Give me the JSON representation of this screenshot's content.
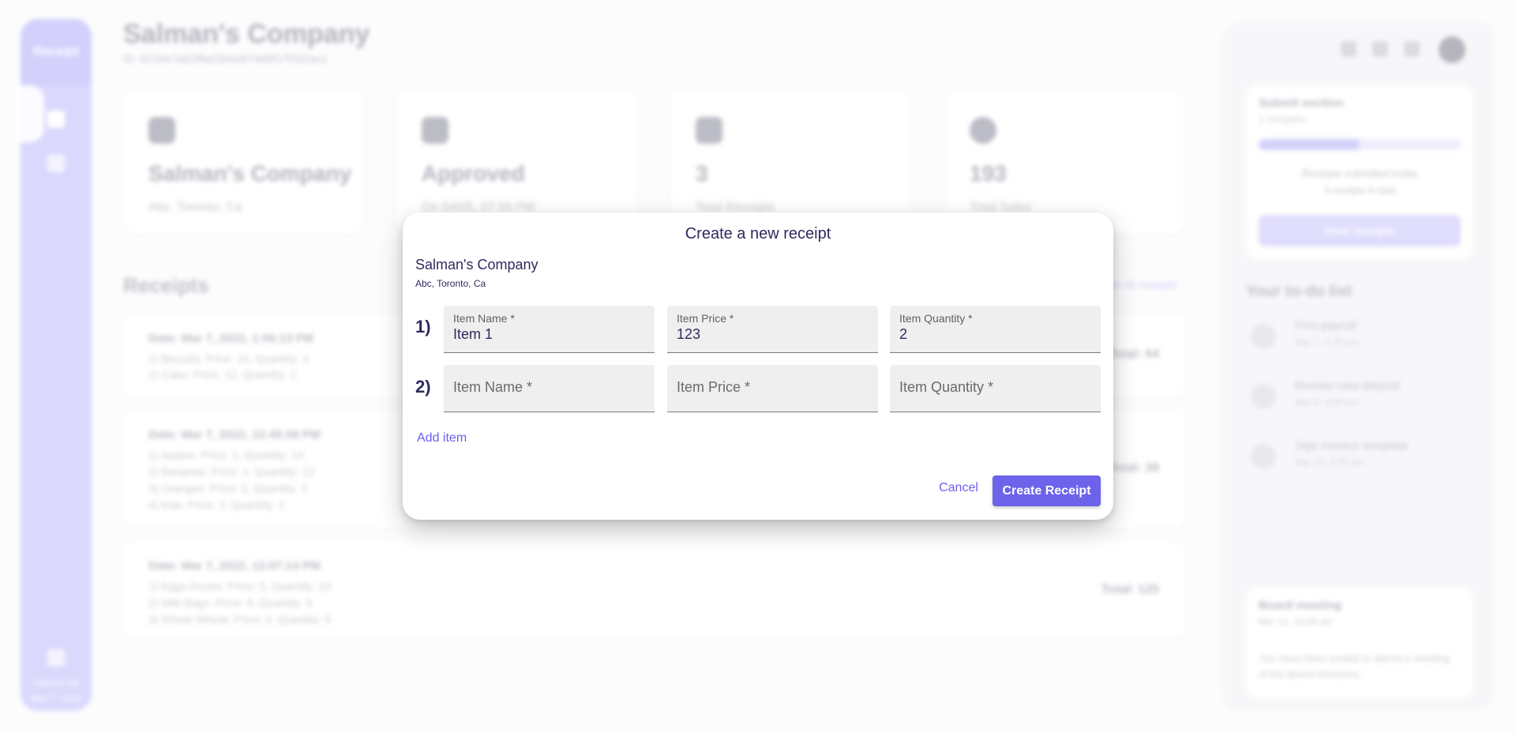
{
  "background": {
    "sidebar": {
      "brand": "Receipt",
      "user_name": "Salman Ali",
      "user_sub": "Mar 7, 2022"
    },
    "header": {
      "title": "Salman's Company",
      "subtitle": "ID: 6234e7ad1f8a22b4a87a66f17f2b2ac1"
    },
    "cards": [
      {
        "value": "Salman's Company",
        "label": "Abc, Toronto, Ca",
        "icon": "briefcase-icon"
      },
      {
        "value": "Approved",
        "label": "On 04/05, 07:56 PM",
        "icon": "check-icon"
      },
      {
        "value": "3",
        "label": "Total Receipts",
        "icon": "receipt-icon"
      },
      {
        "value": "193",
        "label": "Total Sales",
        "icon": "dollar-icon"
      }
    ],
    "receipts_section": {
      "title": "Receipts",
      "view_all": "View all receipts"
    },
    "receipts": [
      {
        "date": "Date: Mar 7, 2022, 1:06:13 PM",
        "items": [
          "1) Biscuits: Price: 10, Quantity: 4",
          "2) Cake: Price: 12, Quantity: 2"
        ],
        "total": "Total: 64"
      },
      {
        "date": "Date: Mar 7, 2022, 12:45:58 PM",
        "items": [
          "1) Apples: Price: 1, Quantity: 10",
          "2) Bananas: Price: 1, Quantity: 12",
          "3) Oranges: Price: 2, Quantity: 3",
          "4) Kiwi: Price: 2, Quantity: 2"
        ],
        "total": "Total: 38"
      },
      {
        "date": "Date: Mar 7, 2022, 12:07:14 PM",
        "items": [
          "1) Eggs Dozen: Price: 5, Quantity: 10",
          "2) Milk Bags: Price: 8, Quantity: 5",
          "3) Whole Wheat: Price: 5, Quantity: 5"
        ],
        "total": "Total: 125"
      }
    ],
    "right_panel": {
      "progress": {
        "title": "Submit section",
        "sub": "1 complete",
        "text": "Receipts submitted today",
        "text2": "3 receipts in total",
        "button": "View receipts",
        "fraction": 0.5
      },
      "todo_title": "Your to-do list",
      "todos": [
        {
          "name": "First payroll",
          "date": "Mar 7, 2:30 pm"
        },
        {
          "name": "Review new deposit",
          "date": "Mar 8, 3:00 pm"
        },
        {
          "name": "Sign Invoice template",
          "date": "Mar 10, 2:00 pm"
        }
      ],
      "meeting": {
        "title": "Board meeting",
        "date": "Mar 12, 10:00 am",
        "text": "You have been invited to attend a meeting of the Board Directors."
      }
    }
  },
  "dialog": {
    "title": "Create a new receipt",
    "company_name": "Salman's Company",
    "company_address": "Abc, Toronto, Ca",
    "rows": [
      {
        "number": "1)",
        "name_label": "Item Name *",
        "name_value": "Item 1",
        "price_label": "Item Price *",
        "price_value": "123",
        "qty_label": "Item Quantity *",
        "qty_value": "2"
      },
      {
        "number": "2)",
        "name_label": "Item Name *",
        "name_value": "",
        "price_label": "Item Price *",
        "price_value": "",
        "qty_label": "Item Quantity *",
        "qty_value": ""
      }
    ],
    "add_item": "Add item",
    "cancel": "Cancel",
    "create": "Create Receipt"
  },
  "colors": {
    "accent": "#6c63ea",
    "text": "#2e2b5e",
    "sidebar": "#c7c4fb",
    "field_bg": "#efefef"
  }
}
